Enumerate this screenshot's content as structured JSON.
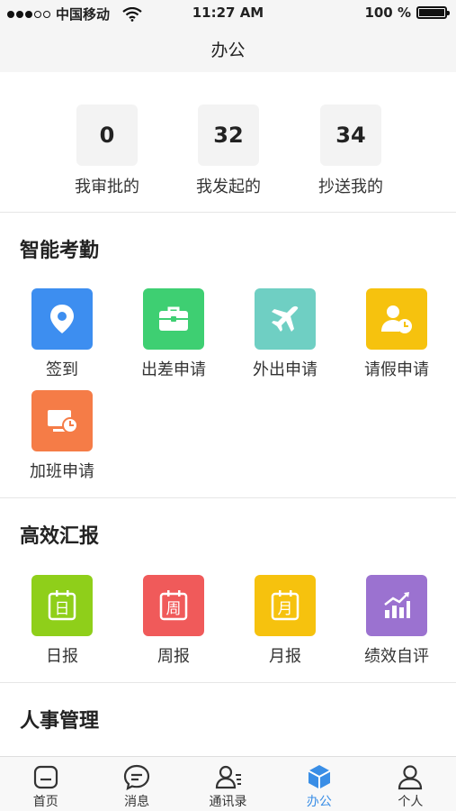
{
  "status_bar": {
    "carrier": "中国移动",
    "time": "11:27 AM",
    "battery": "100 %",
    "battery_level": 1.0
  },
  "nav": {
    "title": "办公"
  },
  "stats": [
    {
      "value": "0",
      "label": "我审批的"
    },
    {
      "value": "32",
      "label": "我发起的"
    },
    {
      "value": "34",
      "label": "抄送我的"
    }
  ],
  "attendance": {
    "title": "智能考勤",
    "items": [
      {
        "label": "签到",
        "icon": "location-pin-icon",
        "color": "#3d8ef0"
      },
      {
        "label": "出差申请",
        "icon": "briefcase-icon",
        "color": "#3ecf72"
      },
      {
        "label": "外出申请",
        "icon": "airplane-icon",
        "color": "#6fcfc3"
      },
      {
        "label": "请假申请",
        "icon": "user-clock-icon",
        "color": "#f6c20e"
      },
      {
        "label": "加班申请",
        "icon": "monitor-clock-icon",
        "color": "#f57c47"
      }
    ]
  },
  "reports": {
    "title": "高效汇报",
    "items": [
      {
        "label": "日报",
        "glyph": "日",
        "icon": "calendar-day-icon",
        "color": "#8fcf1a"
      },
      {
        "label": "周报",
        "glyph": "周",
        "icon": "calendar-week-icon",
        "color": "#f05a5a"
      },
      {
        "label": "月报",
        "glyph": "月",
        "icon": "calendar-month-icon",
        "color": "#f6c20e"
      },
      {
        "label": "绩效自评",
        "icon": "bar-chart-icon",
        "color": "#9b72d0"
      }
    ]
  },
  "hr": {
    "title": "人事管理"
  },
  "tab_bar": {
    "active_color": "#3a8ee6",
    "tabs": [
      {
        "label": "首页",
        "icon": "home-icon"
      },
      {
        "label": "消息",
        "icon": "message-icon"
      },
      {
        "label": "通讯录",
        "icon": "contacts-icon"
      },
      {
        "label": "办公",
        "icon": "cube-icon",
        "active": true
      },
      {
        "label": "个人",
        "icon": "person-icon"
      }
    ]
  }
}
